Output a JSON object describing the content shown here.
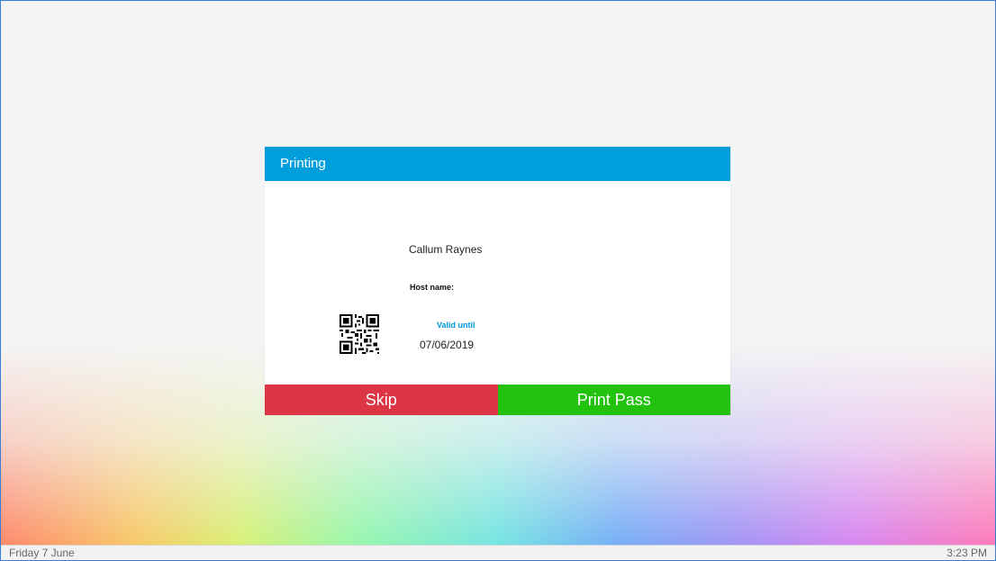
{
  "dialog": {
    "title": "Printing",
    "visitor_name": "Callum Raynes",
    "host_label": "Host name:",
    "valid_label": "Valid until",
    "valid_date": "07/06/2019",
    "qr_icon": "qr-code-icon"
  },
  "actions": {
    "skip_label": "Skip",
    "print_label": "Print Pass"
  },
  "status_bar": {
    "date": "Friday 7 June",
    "time": "3:23 PM"
  },
  "colors": {
    "header": "#009fdc",
    "skip": "#dc3545",
    "print": "#22c20f",
    "valid_label": "#0097d9"
  }
}
